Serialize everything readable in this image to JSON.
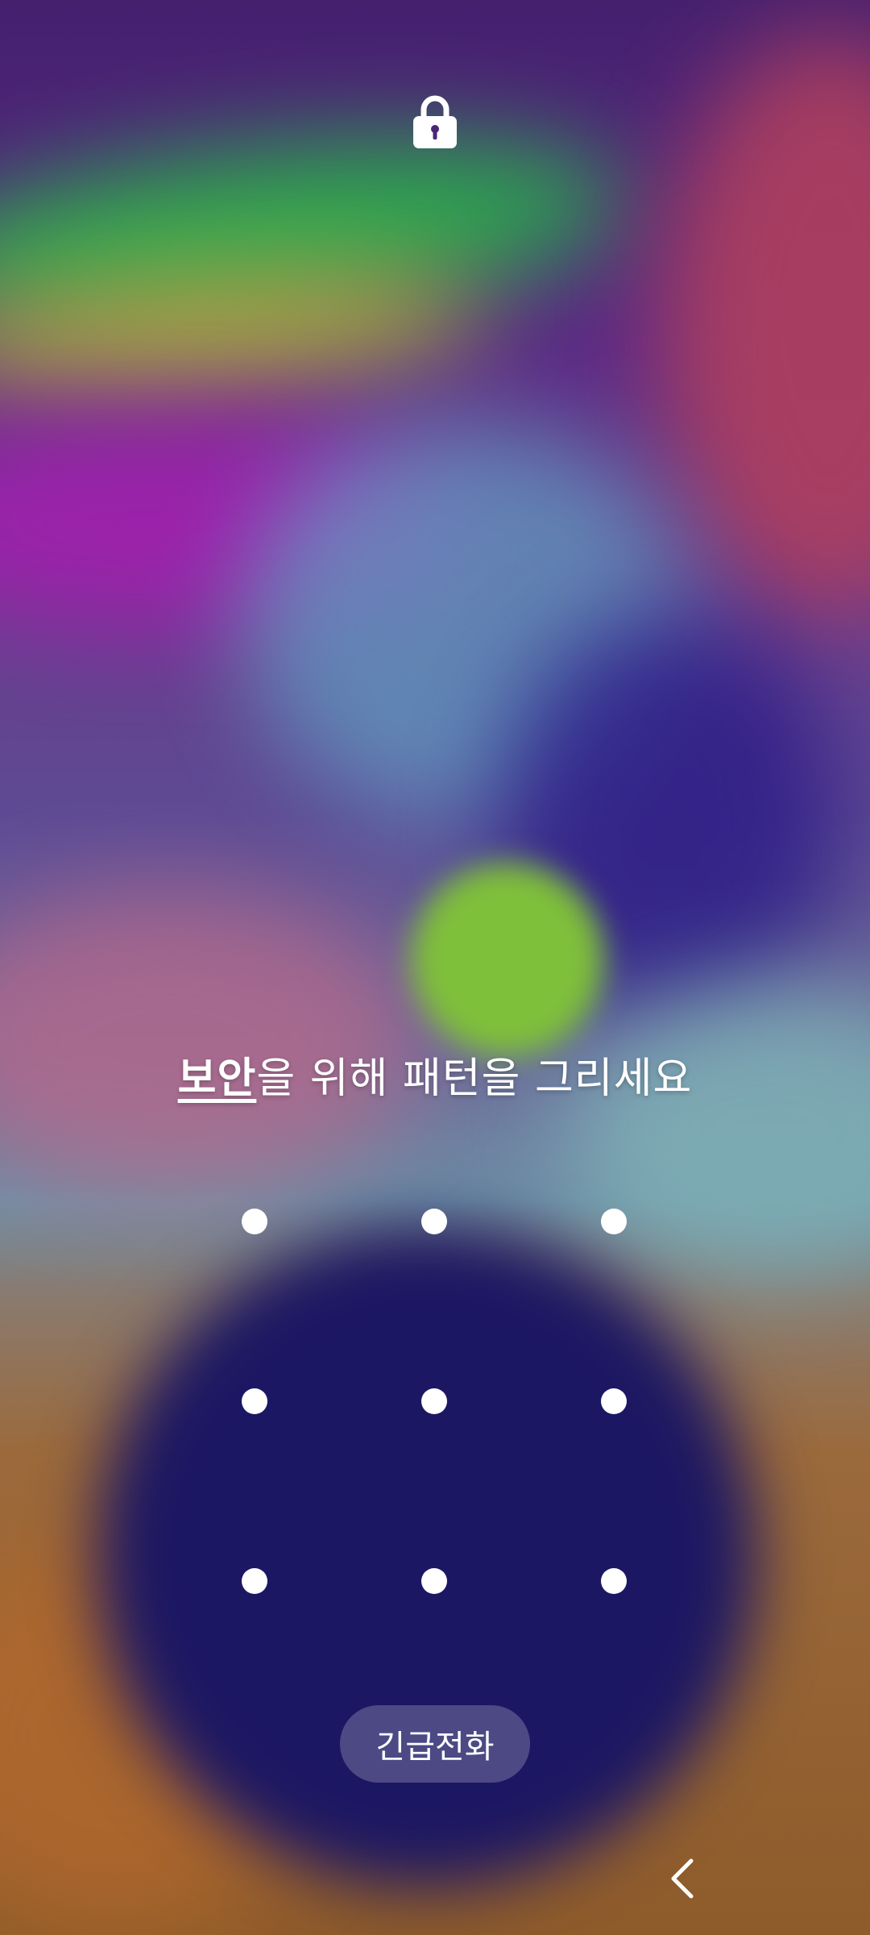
{
  "prompt": {
    "link_text": "보안",
    "text": "을 위해 패턴을 그리세요"
  },
  "emergency_button": {
    "label": "긴급전화"
  },
  "icons": {
    "lock": "lock-icon",
    "back": "back-chevron-icon"
  },
  "colors": {
    "foreground": "#ffffff",
    "button_bg": "rgba(255,255,255,0.22)"
  }
}
